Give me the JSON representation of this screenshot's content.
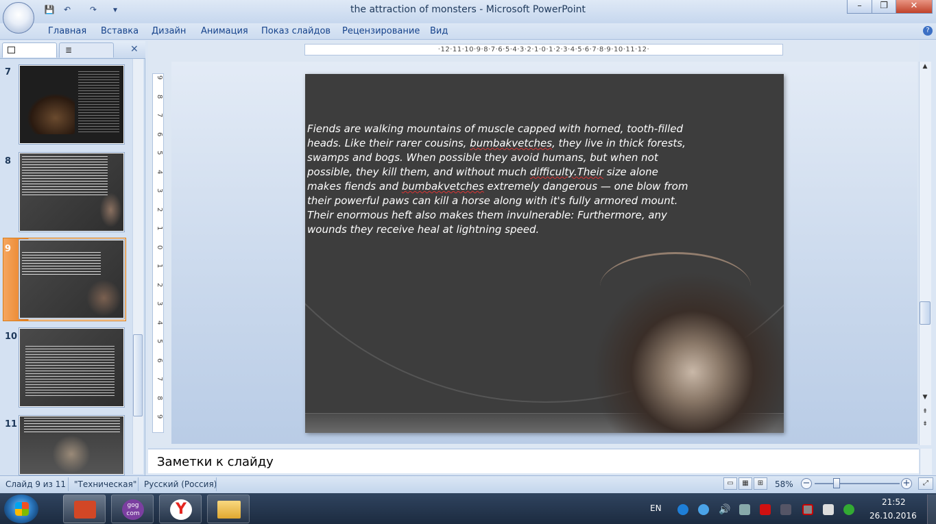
{
  "window": {
    "title": "the attraction of monsters - Microsoft PowerPoint",
    "minimize": "–",
    "restore": "❐",
    "close": "✕"
  },
  "quick_access": {
    "save": "💾",
    "undo": "↶",
    "redo": "↷",
    "more": "▾"
  },
  "ribbon_tabs": [
    "Главная",
    "Вставка",
    "Дизайн",
    "Анимация",
    "Показ слайдов",
    "Рецензирование",
    "Вид"
  ],
  "help": "?",
  "slides_pane": {
    "close": "✕",
    "slides": [
      {
        "number": "7"
      },
      {
        "number": "8"
      },
      {
        "number": "9",
        "selected": true
      },
      {
        "number": "10"
      },
      {
        "number": "11"
      }
    ]
  },
  "ruler": {
    "horizontal": "·12·11·10·9·8·7·6·5·4·3·2·1·0·1·2·3·4·5·6·7·8·9·10·11·12·",
    "vertical": [
      "9",
      "8",
      "7",
      "6",
      "5",
      "4",
      "3",
      "2",
      "1",
      "0",
      "1",
      "2",
      "3",
      "4",
      "5",
      "6",
      "7",
      "8",
      "9"
    ]
  },
  "slide": {
    "text_parts": [
      "Fiends are walking mountains of muscle capped with horned, tooth-filled heads. Like their rarer cousins, ",
      "bumbakvetches",
      ", they live in thick forests, swamps and bogs. When possible they avoid humans, but when not possible, they kill them, and without much ",
      "difficulty.Their",
      " size alone makes fiends and ",
      "bumbakvetches",
      " extremely dangerous — one blow from their powerful paws can kill a horse along with it's fully armored mount. Their enormous heft also makes them invulnerable:  Furthermore, any wounds they receive heal at lightning speed."
    ]
  },
  "notes": {
    "placeholder": "Заметки к слайду"
  },
  "status": {
    "slide_counter": "Слайд 9 из 11",
    "theme": "\"Техническая\"",
    "language": "Русский (Россия)",
    "zoom": "58%"
  },
  "taskbar": {
    "lang": "EN",
    "time": "21:52",
    "date": "26.10.2016",
    "apps": [
      "powerpoint",
      "gog",
      "yandex",
      "explorer"
    ],
    "gog_label": "gog\ncom"
  },
  "colors": {
    "accent": "#e87e1e",
    "slide_bg": "#3d3d3d"
  }
}
